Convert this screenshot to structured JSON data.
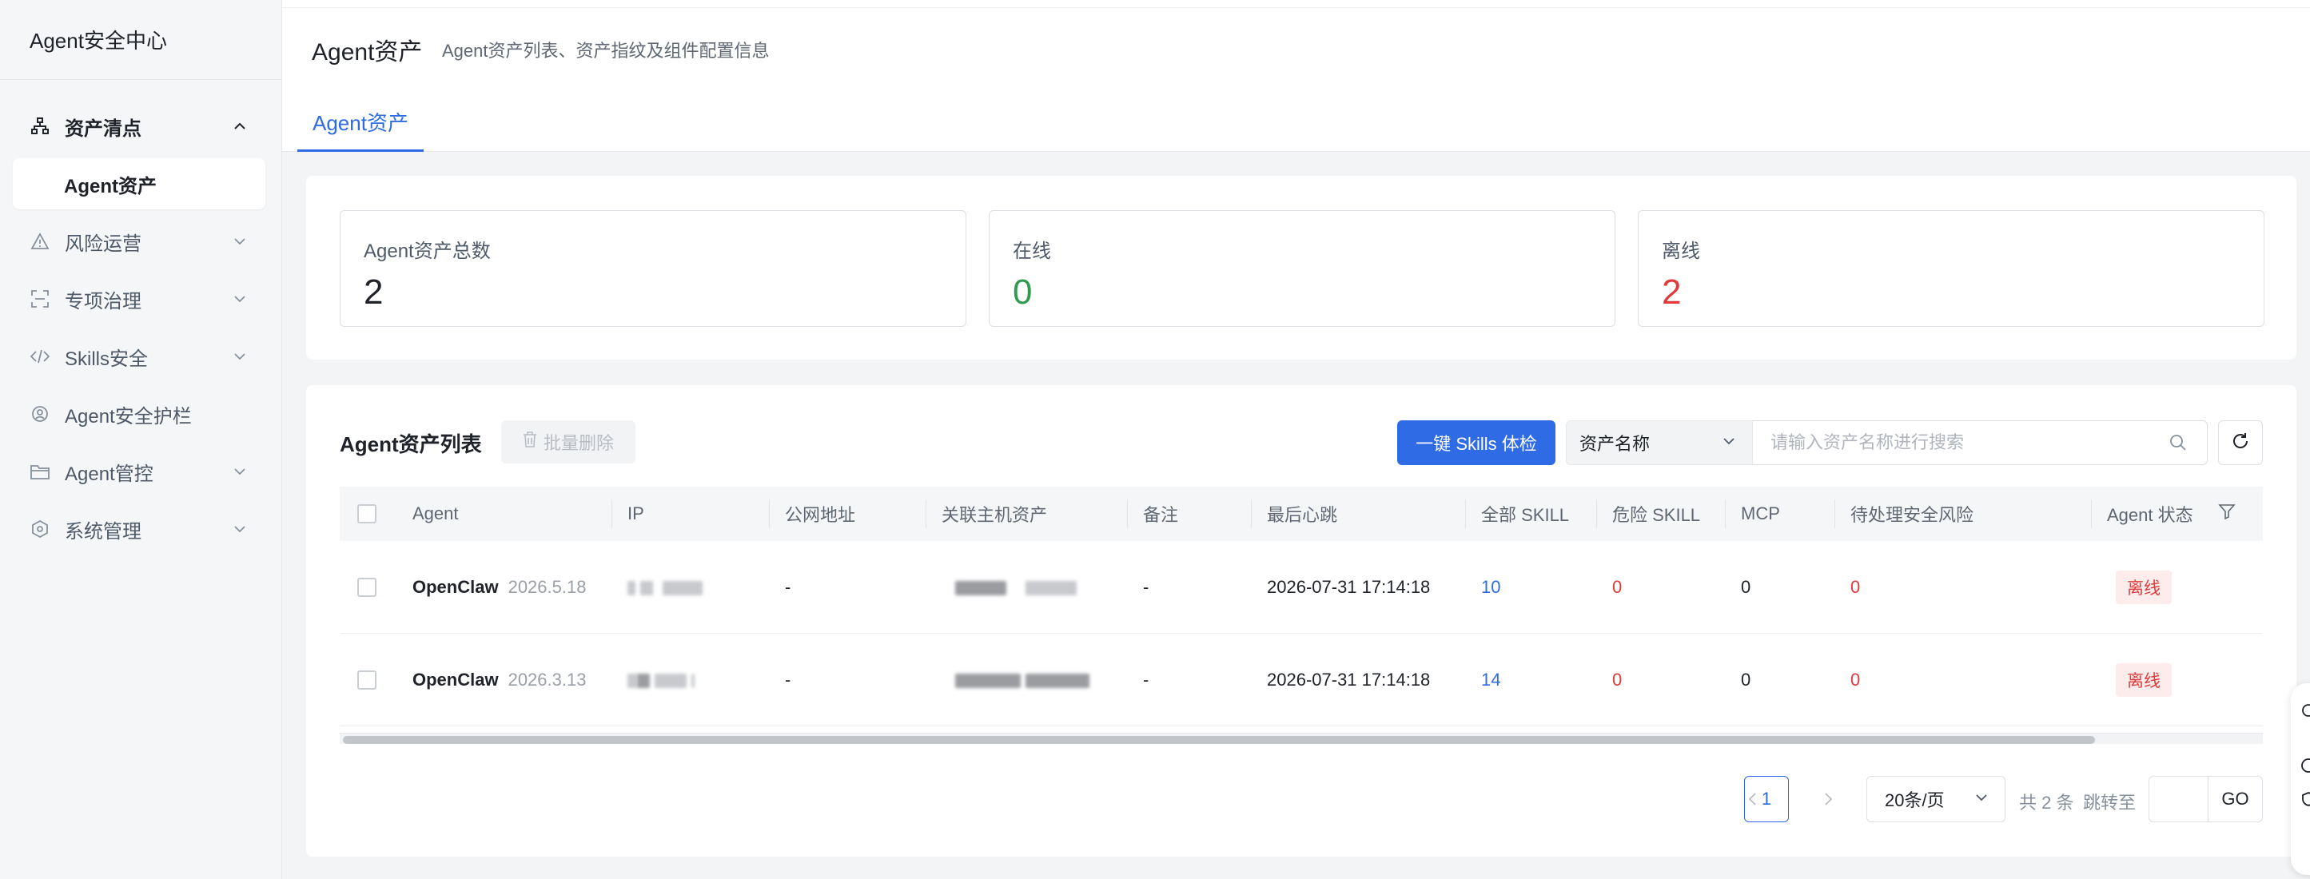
{
  "app": {
    "brand": "Agent安全中心"
  },
  "sidebar": {
    "items": [
      {
        "label": "资产清点",
        "icon": "network-icon",
        "expanded": true
      },
      {
        "label": "Agent资产",
        "sub": true,
        "active": true
      },
      {
        "label": "风险运营",
        "icon": "warning-icon"
      },
      {
        "label": "专项治理",
        "icon": "scan-icon"
      },
      {
        "label": "Skills安全",
        "icon": "code-icon"
      },
      {
        "label": "Agent安全护栏",
        "icon": "location-icon"
      },
      {
        "label": "Agent管控",
        "icon": "folder-icon"
      },
      {
        "label": "系统管理",
        "icon": "settings-icon"
      }
    ]
  },
  "header": {
    "title": "Agent资产",
    "subtitle": "Agent资产列表、资产指纹及组件配置信息",
    "tab": "Agent资产"
  },
  "stats": [
    {
      "label": "Agent资产总数",
      "value": "2",
      "color": "#1f2329"
    },
    {
      "label": "在线",
      "value": "0",
      "color": "#2e9b4f"
    },
    {
      "label": "离线",
      "value": "2",
      "color": "#e03a3a"
    }
  ],
  "list": {
    "title": "Agent资产列表",
    "batch_delete": "批量删除",
    "skills_check": "一键 Skills 体检",
    "search_select": "资产名称",
    "search_placeholder": "请输入资产名称进行搜索",
    "columns": [
      "Agent",
      "IP",
      "公网地址",
      "关联主机资产",
      "备注",
      "最后心跳",
      "全部 SKILL",
      "危险 SKILL",
      "MCP",
      "待处理安全风险",
      "Agent 状态"
    ],
    "rows": [
      {
        "agent": "OpenClaw",
        "version": "2026.5.18",
        "public": "-",
        "remark": "-",
        "heartbeat": "2026-07-31 17:14:18",
        "all_skill": "10",
        "danger_skill": "0",
        "mcp": "0",
        "risk": "0",
        "status": "离线"
      },
      {
        "agent": "OpenClaw",
        "version": "2026.3.13",
        "public": "-",
        "remark": "-",
        "heartbeat": "2026-07-31 17:14:18",
        "all_skill": "14",
        "danger_skill": "0",
        "mcp": "0",
        "risk": "0",
        "status": "离线"
      }
    ]
  },
  "pagination": {
    "current": "1",
    "page_size": "20条/页",
    "total": "共 2 条",
    "goto_label": "跳转至",
    "go": "GO"
  },
  "colors": {
    "accent": "#2f6be5",
    "danger": "#e03a3a",
    "success": "#2e9b4f"
  }
}
